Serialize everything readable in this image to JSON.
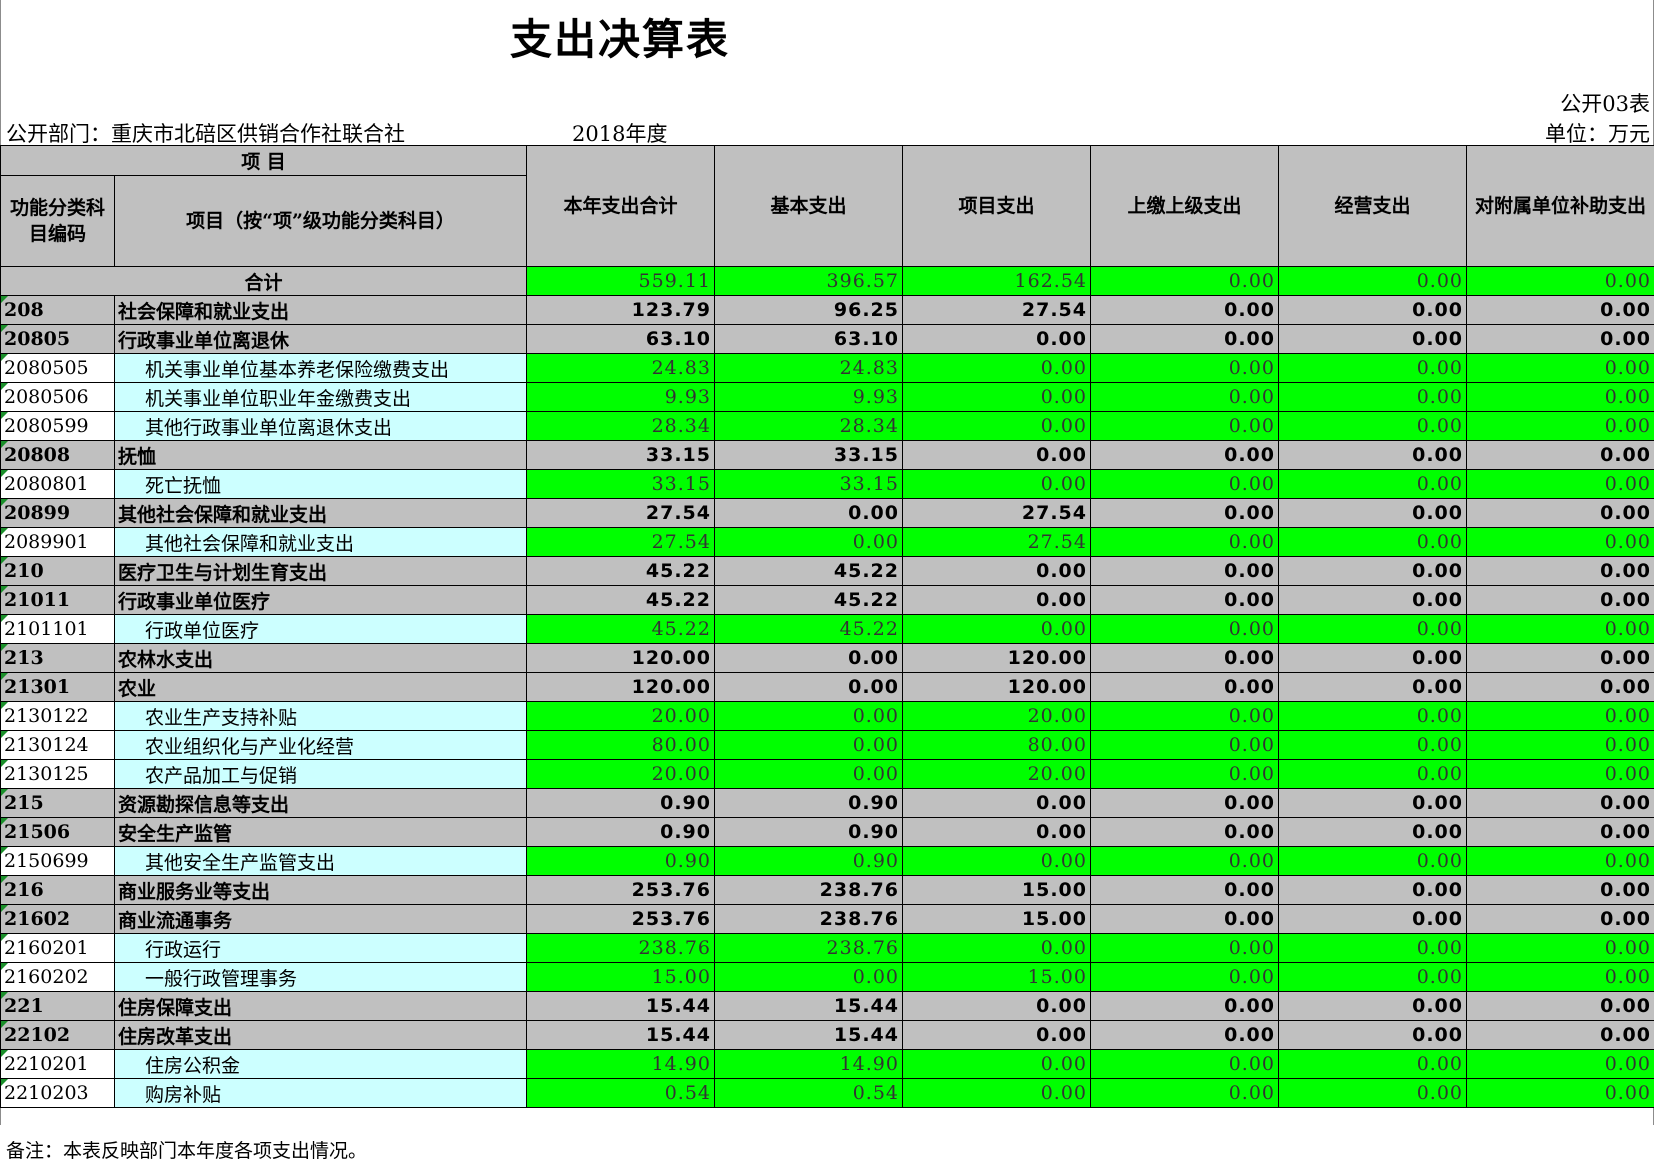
{
  "title": "支出决算表",
  "form_no": "公开03表",
  "department": "公开部门：重庆市北碚区供销合作社联合社",
  "year": "2018年度",
  "unit": "单位：万元",
  "header": {
    "project": "项          目",
    "code": "功能分类科目编码",
    "name": "项目（按“项”级功能分类科目）",
    "col_total": "本年支出合计",
    "col_basic": "基本支出",
    "col_project": "项目支出",
    "col_upper": "上缴上级支出",
    "col_business": "经营支出",
    "col_subsidy": "对附属单位补助支出"
  },
  "total": {
    "label": "合计",
    "values": [
      "559.11",
      "396.57",
      "162.54",
      "0.00",
      "0.00",
      "0.00"
    ]
  },
  "rows": [
    {
      "code": "208",
      "name": "社会保障和就业支出",
      "level": "grey",
      "values": [
        "123.79",
        "96.25",
        "27.54",
        "0.00",
        "0.00",
        "0.00"
      ]
    },
    {
      "code": "20805",
      "name": "行政事业单位离退休",
      "level": "grey",
      "values": [
        "63.10",
        "63.10",
        "0.00",
        "0.00",
        "0.00",
        "0.00"
      ]
    },
    {
      "code": "2080505",
      "name": "机关事业单位基本养老保险缴费支出",
      "level": "detail",
      "values": [
        "24.83",
        "24.83",
        "0.00",
        "0.00",
        "0.00",
        "0.00"
      ]
    },
    {
      "code": "2080506",
      "name": "机关事业单位职业年金缴费支出",
      "level": "detail",
      "values": [
        "9.93",
        "9.93",
        "0.00",
        "0.00",
        "0.00",
        "0.00"
      ]
    },
    {
      "code": "2080599",
      "name": "其他行政事业单位离退休支出",
      "level": "detail",
      "values": [
        "28.34",
        "28.34",
        "0.00",
        "0.00",
        "0.00",
        "0.00"
      ]
    },
    {
      "code": "20808",
      "name": "抚恤",
      "level": "grey",
      "values": [
        "33.15",
        "33.15",
        "0.00",
        "0.00",
        "0.00",
        "0.00"
      ]
    },
    {
      "code": "2080801",
      "name": "死亡抚恤",
      "level": "detail",
      "values": [
        "33.15",
        "33.15",
        "0.00",
        "0.00",
        "0.00",
        "0.00"
      ]
    },
    {
      "code": "20899",
      "name": "其他社会保障和就业支出",
      "level": "grey",
      "values": [
        "27.54",
        "0.00",
        "27.54",
        "0.00",
        "0.00",
        "0.00"
      ]
    },
    {
      "code": "2089901",
      "name": "其他社会保障和就业支出",
      "level": "detail",
      "values": [
        "27.54",
        "0.00",
        "27.54",
        "0.00",
        "0.00",
        "0.00"
      ]
    },
    {
      "code": "210",
      "name": "医疗卫生与计划生育支出",
      "level": "grey",
      "values": [
        "45.22",
        "45.22",
        "0.00",
        "0.00",
        "0.00",
        "0.00"
      ]
    },
    {
      "code": "21011",
      "name": "行政事业单位医疗",
      "level": "grey",
      "values": [
        "45.22",
        "45.22",
        "0.00",
        "0.00",
        "0.00",
        "0.00"
      ]
    },
    {
      "code": "2101101",
      "name": "行政单位医疗",
      "level": "detail",
      "values": [
        "45.22",
        "45.22",
        "0.00",
        "0.00",
        "0.00",
        "0.00"
      ]
    },
    {
      "code": "213",
      "name": "农林水支出",
      "level": "grey",
      "values": [
        "120.00",
        "0.00",
        "120.00",
        "0.00",
        "0.00",
        "0.00"
      ]
    },
    {
      "code": "21301",
      "name": "农业",
      "level": "grey",
      "values": [
        "120.00",
        "0.00",
        "120.00",
        "0.00",
        "0.00",
        "0.00"
      ]
    },
    {
      "code": "2130122",
      "name": "农业生产支持补贴",
      "level": "detail",
      "values": [
        "20.00",
        "0.00",
        "20.00",
        "0.00",
        "0.00",
        "0.00"
      ]
    },
    {
      "code": "2130124",
      "name": "农业组织化与产业化经营",
      "level": "detail",
      "values": [
        "80.00",
        "0.00",
        "80.00",
        "0.00",
        "0.00",
        "0.00"
      ]
    },
    {
      "code": "2130125",
      "name": "农产品加工与促销",
      "level": "detail",
      "values": [
        "20.00",
        "0.00",
        "20.00",
        "0.00",
        "0.00",
        "0.00"
      ]
    },
    {
      "code": "215",
      "name": "资源勘探信息等支出",
      "level": "grey",
      "values": [
        "0.90",
        "0.90",
        "0.00",
        "0.00",
        "0.00",
        "0.00"
      ]
    },
    {
      "code": "21506",
      "name": "安全生产监管",
      "level": "grey",
      "values": [
        "0.90",
        "0.90",
        "0.00",
        "0.00",
        "0.00",
        "0.00"
      ]
    },
    {
      "code": "2150699",
      "name": "其他安全生产监管支出",
      "level": "detail",
      "values": [
        "0.90",
        "0.90",
        "0.00",
        "0.00",
        "0.00",
        "0.00"
      ]
    },
    {
      "code": "216",
      "name": "商业服务业等支出",
      "level": "grey",
      "values": [
        "253.76",
        "238.76",
        "15.00",
        "0.00",
        "0.00",
        "0.00"
      ]
    },
    {
      "code": "21602",
      "name": "商业流通事务",
      "level": "grey",
      "values": [
        "253.76",
        "238.76",
        "15.00",
        "0.00",
        "0.00",
        "0.00"
      ]
    },
    {
      "code": "2160201",
      "name": "行政运行",
      "level": "detail",
      "values": [
        "238.76",
        "238.76",
        "0.00",
        "0.00",
        "0.00",
        "0.00"
      ]
    },
    {
      "code": "2160202",
      "name": "一般行政管理事务",
      "level": "detail",
      "values": [
        "15.00",
        "0.00",
        "15.00",
        "0.00",
        "0.00",
        "0.00"
      ]
    },
    {
      "code": "221",
      "name": "住房保障支出",
      "level": "grey",
      "values": [
        "15.44",
        "15.44",
        "0.00",
        "0.00",
        "0.00",
        "0.00"
      ]
    },
    {
      "code": "22102",
      "name": "住房改革支出",
      "level": "grey",
      "values": [
        "15.44",
        "15.44",
        "0.00",
        "0.00",
        "0.00",
        "0.00"
      ]
    },
    {
      "code": "2210201",
      "name": "住房公积金",
      "level": "detail",
      "values": [
        "14.90",
        "14.90",
        "0.00",
        "0.00",
        "0.00",
        "0.00"
      ]
    },
    {
      "code": "2210203",
      "name": "购房补贴",
      "level": "detail",
      "values": [
        "0.54",
        "0.54",
        "0.00",
        "0.00",
        "0.00",
        "0.00"
      ]
    }
  ],
  "note": "备注：本表反映部门本年度各项支出情况。",
  "colors": {
    "header_grey": "#c0c0c0",
    "value_green": "#00ff00",
    "detail_cyan": "#ccffff",
    "corner_mark": "#1a8f2a"
  }
}
